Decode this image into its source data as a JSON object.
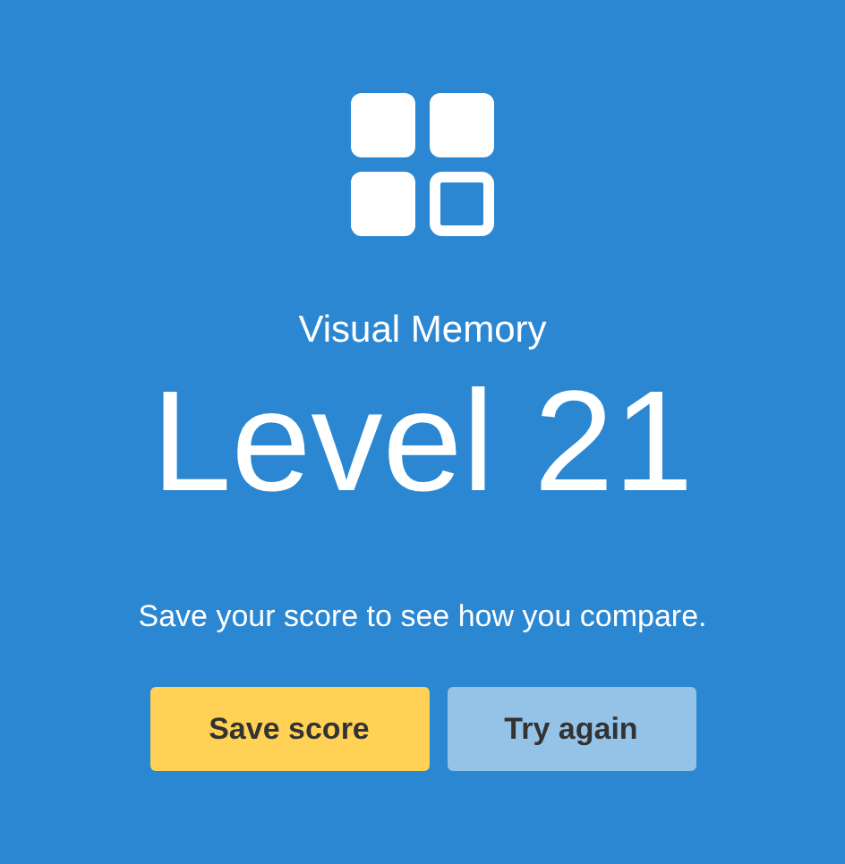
{
  "test_name": "Visual Memory",
  "result": "Level 21",
  "message": "Save your score to see how you compare.",
  "buttons": [
    {
      "label": "Save score",
      "kind": "primary"
    },
    {
      "label": "Try again",
      "kind": "secondary"
    }
  ]
}
